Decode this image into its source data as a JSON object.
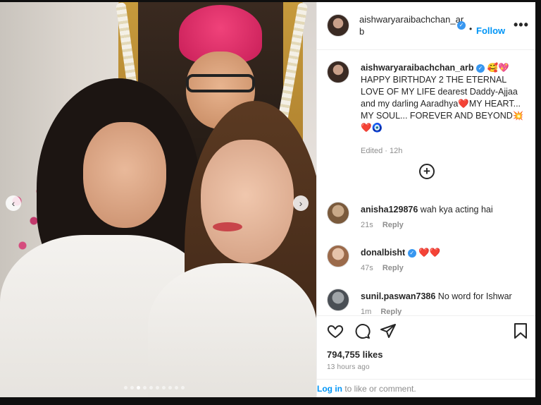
{
  "post": {
    "photo_alt": "",
    "carousel": {
      "count": 10,
      "active_index": 2
    },
    "header": {
      "username": "aishwaryaraibachchan_arb",
      "follow_separator": "•",
      "follow_label": "Follow",
      "more_label": "•••"
    },
    "caption": {
      "username": "aishwaryaraibachchan_arb",
      "text": "🥰💖 HAPPY BIRTHDAY 2 THE ETERNAL LOVE OF MY LIFE dearest Daddy-Ajjaa and my darling Aaradhya❤️MY HEART... MY SOUL... FOREVER AND BEYOND💥❤️🧿",
      "meta": "Edited · 12h"
    },
    "comments": [
      {
        "username": "anisha129876",
        "text": "wah kya acting hai",
        "time": "21s",
        "reply_label": "Reply"
      },
      {
        "username": "donalbisht",
        "text": "❤️❤️",
        "time": "47s",
        "reply_label": "Reply"
      },
      {
        "username": "sunil.paswan7386",
        "text": "No word for Ishwar",
        "time": "1m",
        "reply_label": "Reply"
      }
    ],
    "likes": "794,755 likes",
    "time_ago": "13 hours ago",
    "login": {
      "link": "Log in",
      "rest": " to like or comment."
    }
  }
}
